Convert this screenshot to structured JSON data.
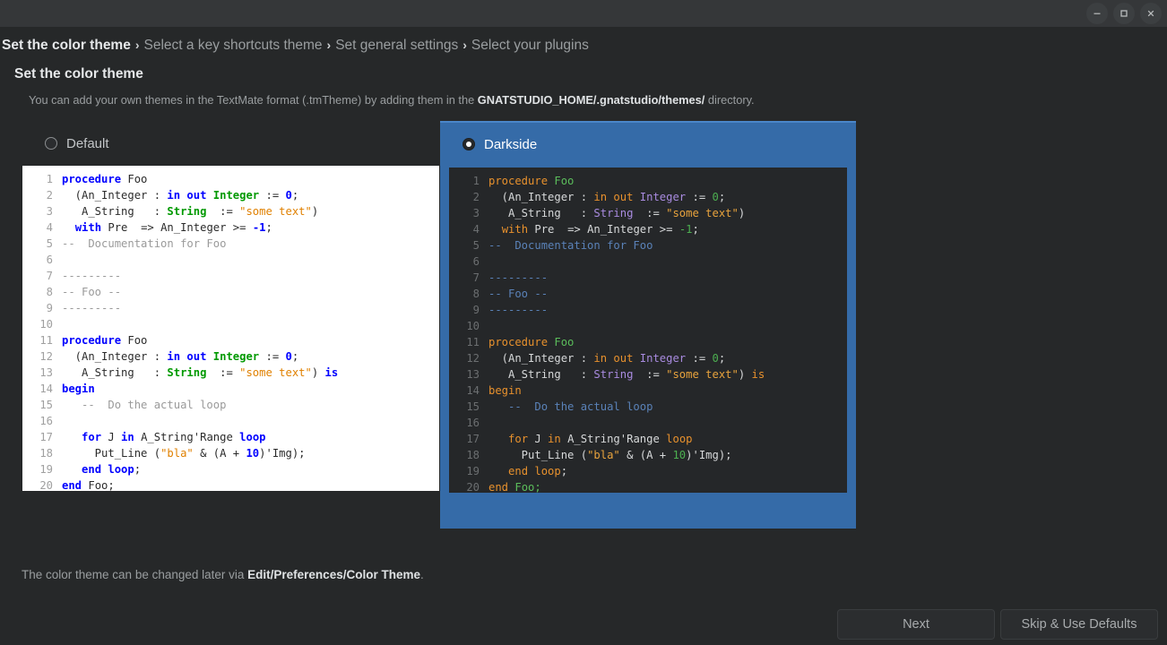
{
  "window": {
    "controls": [
      {
        "name": "minimize-button",
        "glyph": "minimize"
      },
      {
        "name": "maximize-button",
        "glyph": "maximize"
      },
      {
        "name": "close-button",
        "glyph": "close"
      }
    ]
  },
  "breadcrumb": {
    "separator": "›",
    "items": [
      {
        "label": "Set the color theme",
        "active": true
      },
      {
        "label": "Select a key shortcuts theme",
        "active": false
      },
      {
        "label": "Set general settings",
        "active": false
      },
      {
        "label": "Select your plugins",
        "active": false
      }
    ]
  },
  "section": {
    "title": "Set the color theme",
    "description_pre": "You can add your own themes in the TextMate format (.tmTheme) by adding them in the ",
    "description_bold": "GNATSTUDIO_HOME/.gnatstudio/themes/",
    "description_post": " directory."
  },
  "themes": [
    {
      "name": "Default",
      "selected": false
    },
    {
      "name": "Darkside",
      "selected": true
    }
  ],
  "code": {
    "lines": [
      {
        "n": "1",
        "tokens": [
          {
            "t": "procedure",
            "c": "k"
          },
          {
            "t": " Foo",
            "c": "fn_or_id"
          }
        ]
      },
      {
        "n": "2",
        "tokens": [
          {
            "t": "  (An_Integer : ",
            "c": "id"
          },
          {
            "t": "in out",
            "c": "k"
          },
          {
            "t": " ",
            "c": "id"
          },
          {
            "t": "Integer",
            "c": "ty"
          },
          {
            "t": " := ",
            "c": "id"
          },
          {
            "t": "0",
            "c": "num"
          },
          {
            "t": ";",
            "c": "id"
          }
        ]
      },
      {
        "n": "3",
        "tokens": [
          {
            "t": "   A_String   : ",
            "c": "id"
          },
          {
            "t": "String",
            "c": "ty"
          },
          {
            "t": "  := ",
            "c": "id"
          },
          {
            "t": "\"some text\"",
            "c": "st"
          },
          {
            "t": ")",
            "c": "id"
          }
        ]
      },
      {
        "n": "4",
        "tokens": [
          {
            "t": "  ",
            "c": "id"
          },
          {
            "t": "with",
            "c": "k"
          },
          {
            "t": " Pre  => An_Integer >= ",
            "c": "id"
          },
          {
            "t": "-1",
            "c": "num"
          },
          {
            "t": ";",
            "c": "id"
          }
        ]
      },
      {
        "n": "5",
        "tokens": [
          {
            "t": "--  Documentation for Foo",
            "c": "cm"
          }
        ]
      },
      {
        "n": "6",
        "tokens": [
          {
            "t": "",
            "c": "id"
          }
        ]
      },
      {
        "n": "7",
        "tokens": [
          {
            "t": "---------",
            "c": "cm"
          }
        ]
      },
      {
        "n": "8",
        "tokens": [
          {
            "t": "-- Foo --",
            "c": "cm"
          }
        ]
      },
      {
        "n": "9",
        "tokens": [
          {
            "t": "---------",
            "c": "cm"
          }
        ]
      },
      {
        "n": "10",
        "tokens": [
          {
            "t": "",
            "c": "id"
          }
        ]
      },
      {
        "n": "11",
        "tokens": [
          {
            "t": "procedure",
            "c": "k"
          },
          {
            "t": " Foo",
            "c": "fn_or_id"
          }
        ]
      },
      {
        "n": "12",
        "tokens": [
          {
            "t": "  (An_Integer : ",
            "c": "id"
          },
          {
            "t": "in out",
            "c": "k"
          },
          {
            "t": " ",
            "c": "id"
          },
          {
            "t": "Integer",
            "c": "ty"
          },
          {
            "t": " := ",
            "c": "id"
          },
          {
            "t": "0",
            "c": "num"
          },
          {
            "t": ";",
            "c": "id"
          }
        ]
      },
      {
        "n": "13",
        "tokens": [
          {
            "t": "   A_String   : ",
            "c": "id"
          },
          {
            "t": "String",
            "c": "ty"
          },
          {
            "t": "  := ",
            "c": "id"
          },
          {
            "t": "\"some text\"",
            "c": "st"
          },
          {
            "t": ") ",
            "c": "id"
          },
          {
            "t": "is",
            "c": "k"
          }
        ]
      },
      {
        "n": "14",
        "tokens": [
          {
            "t": "begin",
            "c": "k"
          }
        ]
      },
      {
        "n": "15",
        "tokens": [
          {
            "t": "   --  Do the actual loop",
            "c": "cm"
          }
        ]
      },
      {
        "n": "16",
        "tokens": [
          {
            "t": "",
            "c": "id"
          }
        ]
      },
      {
        "n": "17",
        "tokens": [
          {
            "t": "   ",
            "c": "id"
          },
          {
            "t": "for",
            "c": "k"
          },
          {
            "t": " J ",
            "c": "id"
          },
          {
            "t": "in",
            "c": "k"
          },
          {
            "t": " A_String'Range ",
            "c": "id"
          },
          {
            "t": "loop",
            "c": "k"
          }
        ]
      },
      {
        "n": "18",
        "tokens": [
          {
            "t": "     Put_Line (",
            "c": "id"
          },
          {
            "t": "\"bla\"",
            "c": "st"
          },
          {
            "t": " & (A + ",
            "c": "id"
          },
          {
            "t": "10",
            "c": "num"
          },
          {
            "t": ")'Img);",
            "c": "id"
          }
        ]
      },
      {
        "n": "19",
        "tokens": [
          {
            "t": "   ",
            "c": "id"
          },
          {
            "t": "end",
            "c": "k"
          },
          {
            "t": " ",
            "c": "id"
          },
          {
            "t": "loop",
            "c": "k"
          },
          {
            "t": ";",
            "c": "id"
          }
        ]
      },
      {
        "n": "20",
        "tokens": [
          {
            "t": "end",
            "c": "k"
          },
          {
            "t": " Foo;",
            "c": "fn_or_id"
          }
        ]
      }
    ]
  },
  "footer": {
    "note_pre": "The color theme can be changed later via ",
    "note_bold": "Edit/Preferences/Color Theme",
    "note_post": ".",
    "buttons": [
      {
        "label": "Next",
        "name": "next-button"
      },
      {
        "label": "Skip & Use Defaults",
        "name": "skip-use-defaults-button"
      }
    ]
  },
  "colors": {
    "accent": "#356ba8",
    "background": "#262829",
    "titlebar": "#353739",
    "light_code_bg": "#ffffff",
    "dark_code_bg": "#252729"
  }
}
